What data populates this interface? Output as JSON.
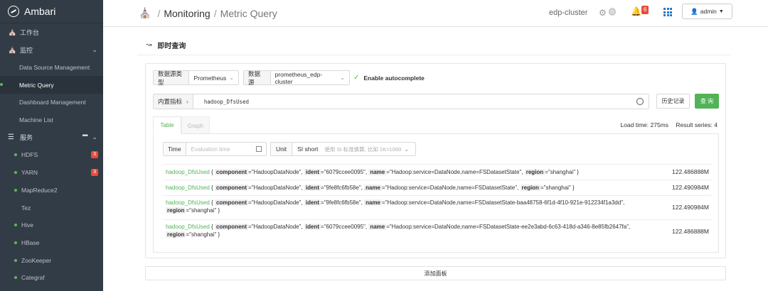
{
  "sidebar": {
    "brand": "Ambari",
    "workbench": "工作台",
    "monitor": "监控",
    "monitor_items": [
      "Data Source Management",
      "Metric Query",
      "Dashboard Management",
      "Machine List"
    ],
    "services_label": "服务",
    "services": [
      {
        "name": "HDFS",
        "badge": "3"
      },
      {
        "name": "YARN",
        "badge": "3"
      },
      {
        "name": "MapReduce2",
        "badge": ""
      },
      {
        "name": "Tez",
        "badge": ""
      },
      {
        "name": "Hive",
        "badge": ""
      },
      {
        "name": "HBase",
        "badge": ""
      },
      {
        "name": "ZooKeeper",
        "badge": ""
      },
      {
        "name": "Categraf",
        "badge": ""
      }
    ]
  },
  "header": {
    "breadcrumb": [
      "Monitoring",
      "Metric Query"
    ],
    "cluster": "edp-cluster",
    "settings_count": "0",
    "alerts_count": "6",
    "user": "admin"
  },
  "main": {
    "title": "即时查询",
    "ds_type_label": "数据源类型",
    "ds_type_value": "Prometheus",
    "ds_label": "数据源",
    "ds_value": "prometheus_edp-cluster",
    "autocomplete": "Enable autocomplete",
    "builtin_label": "内置指标",
    "query": "hadoop_DfsUsed",
    "history_button": "历史记录",
    "query_button": "查 询",
    "tabs": [
      "Table",
      "Graph"
    ],
    "load_time": "Load time: 275ms",
    "result_series": "Result series: 4",
    "time_label": "Time",
    "time_placeholder": "Evaluation time",
    "unit_label": "Unit",
    "unit_value": "SI short",
    "unit_hint": "使用 SI 标准换算, 比如 1K=1000",
    "add_panel": "添加面板"
  },
  "results": [
    {
      "metric": "hadoop_DfsUsed",
      "labels": [
        [
          "component",
          "HadoopDataNode"
        ],
        [
          "ident",
          "6079ccee0095"
        ],
        [
          "name",
          "Hadoop:service=DataNode,name=FSDatasetState"
        ],
        [
          "region",
          "shanghai"
        ]
      ],
      "value": "122.486888M"
    },
    {
      "metric": "hadoop_DfsUsed",
      "labels": [
        [
          "component",
          "HadoopDataNode"
        ],
        [
          "ident",
          "9fe8fc6fb58e"
        ],
        [
          "name",
          "Hadoop:service=DataNode,name=FSDatasetState"
        ],
        [
          "region",
          "shanghai"
        ]
      ],
      "value": "122.490984M"
    },
    {
      "metric": "hadoop_DfsUsed",
      "labels": [
        [
          "component",
          "HadoopDataNode"
        ],
        [
          "ident",
          "9fe8fc6fb58e"
        ],
        [
          "name",
          "Hadoop:service=DataNode,name=FSDatasetState-baa48758-6f1d-4f10-921e-912234f1a3dd"
        ],
        [
          "region",
          "shanghai"
        ]
      ],
      "value": "122.490984M"
    },
    {
      "metric": "hadoop_DfsUsed",
      "labels": [
        [
          "component",
          "HadoopDataNode"
        ],
        [
          "ident",
          "6079ccee0095"
        ],
        [
          "name",
          "Hadoop:service=DataNode,name=FSDatasetState-ee2e3abd-6c63-418d-a346-8e85fb2647fa"
        ],
        [
          "region",
          "shanghai"
        ]
      ],
      "value": "122.486888M"
    }
  ],
  "colors": {
    "sidebar_bg": "#323c46",
    "accent_green": "#52b356",
    "badge_red": "#e74c3c"
  }
}
